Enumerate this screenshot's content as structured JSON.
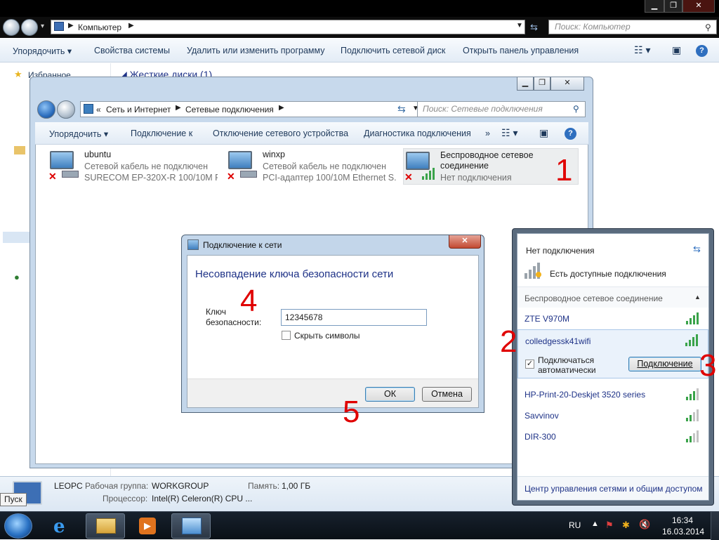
{
  "explorer": {
    "path": "Компьютер",
    "search_placeholder": "Поиск: Компьютер",
    "toolbar": [
      "Упорядочить",
      "Свойства системы",
      "Удалить или изменить программу",
      "Подключить сетевой диск",
      "Открыть панель управления"
    ],
    "nav_favorites": "Избранное",
    "section_heading": "Жесткие диски (1)"
  },
  "details": {
    "computer_name": "LEOPC",
    "workgroup_label": "Рабочая группа:",
    "workgroup_value": "WORKGROUP",
    "memory_label": "Память:",
    "memory_value": "1,00 ГБ",
    "cpu_label": "Процессор:",
    "cpu_value": "Intel(R) Celeron(R) CPU ..."
  },
  "netwin": {
    "breadcrumb_prefix": "«",
    "breadcrumb_1": "Сеть и Интернет",
    "breadcrumb_2": "Сетевые подключения",
    "search_placeholder": "Поиск: Сетевые подключения",
    "toolbar": [
      "Упорядочить",
      "Подключение к",
      "Отключение сетевого устройства",
      "Диагностика подключения"
    ],
    "overflow": "»",
    "connections": [
      {
        "name": "ubuntu",
        "status": "Сетевой кабель не подключен",
        "device": "SURECOM EP-320X-R 100/10M P..."
      },
      {
        "name": "winxp",
        "status": "Сетевой кабель не подключен",
        "device": "PCI-адаптер 100/10M Ethernet S..."
      },
      {
        "name": "Беспроводное сетевое",
        "name2": "соединение",
        "status": "Нет подключения"
      }
    ]
  },
  "dialog": {
    "title": "Подключение к сети",
    "heading": "Несовпадение ключа безопасности сети",
    "key_label_1": "Ключ",
    "key_label_2": "безопасности:",
    "key_value": "12345678",
    "hide_chars": "Скрыть символы",
    "ok": "ОК",
    "cancel": "Отмена"
  },
  "flyout": {
    "status": "Нет подключения",
    "available": "Есть доступные подключения",
    "section": "Беспроводное сетевое соединение",
    "networks": [
      "ZTE V970M",
      "colledgessk41wifi",
      "HP-Print-20-Deskjet 3520 series",
      "Savvinov",
      "DIR-300"
    ],
    "auto_connect_1": "Подключаться",
    "auto_connect_2": "автоматически",
    "connect_button": "Подключение",
    "footer_link": "Центр управления сетями и общим доступом"
  },
  "annotations": [
    "1",
    "2",
    "3",
    "4",
    "5"
  ],
  "taskbar": {
    "tooltip": "Пуск",
    "lang": "RU",
    "time": "16:34",
    "date": "16.03.2014"
  },
  "colors": {
    "annotation": "#e00000",
    "link": "#1e3287",
    "signal": "#3aa34a"
  }
}
